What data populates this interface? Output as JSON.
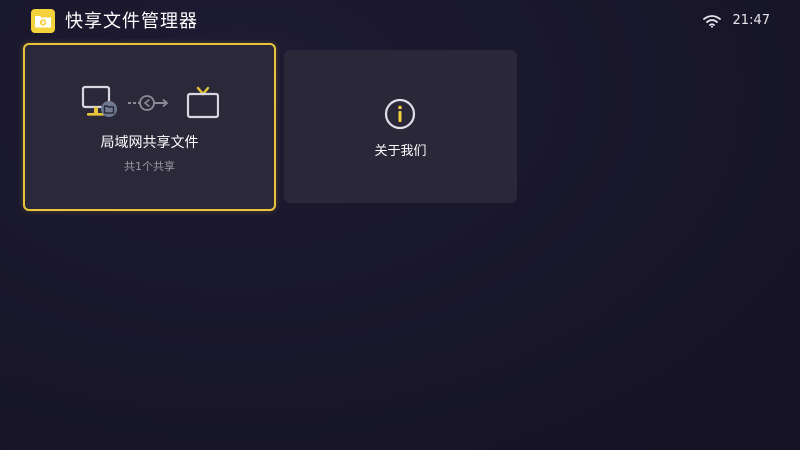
{
  "header": {
    "app_title": "快享文件管理器",
    "logo_icon": "share-folder-icon",
    "status": {
      "wifi_icon": "wifi-icon",
      "time": "21:47"
    }
  },
  "cards": [
    {
      "title": "局域网共享文件",
      "subtitle": "共1个共享",
      "icons": [
        "computer-folder-icon",
        "share-arrow-icon",
        "tv-icon"
      ],
      "focused": true
    },
    {
      "title": "关于我们",
      "icons": [
        "info-icon"
      ],
      "focused": false
    }
  ],
  "colors": {
    "background": "#181629",
    "card": "#2a2838",
    "accent": "#f4d23c",
    "focus_border": "#e8c53a",
    "muted_text": "#9a98a6"
  }
}
